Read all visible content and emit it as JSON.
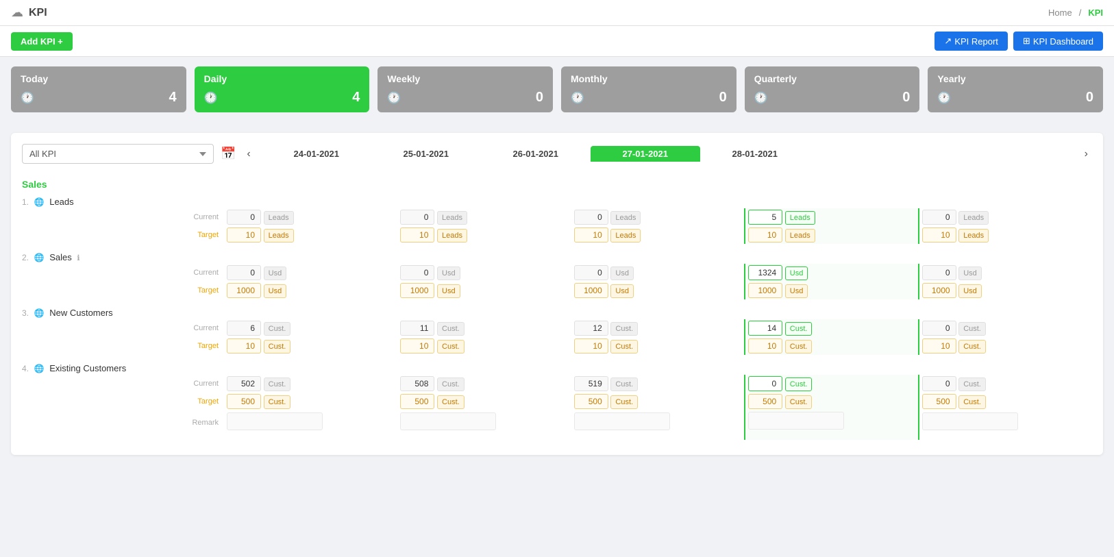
{
  "header": {
    "logo_icon": "☁",
    "title": "KPI",
    "breadcrumb_home": "Home",
    "breadcrumb_sep": "/",
    "breadcrumb_current": "KPI"
  },
  "toolbar": {
    "add_kpi_label": "Add KPI +",
    "report_label": "KPI Report",
    "dashboard_label": "KPI Dashboard"
  },
  "period_cards": [
    {
      "label": "Today",
      "value": "4",
      "active": false
    },
    {
      "label": "Daily",
      "value": "4",
      "active": true
    },
    {
      "label": "Weekly",
      "value": "0",
      "active": false
    },
    {
      "label": "Monthly",
      "value": "0",
      "active": false
    },
    {
      "label": "Quarterly",
      "value": "0",
      "active": false
    },
    {
      "label": "Yearly",
      "value": "0",
      "active": false
    }
  ],
  "filter": {
    "select_label": "All KPI",
    "select_options": [
      "All KPI"
    ]
  },
  "dates": [
    {
      "label": "24-01-2021",
      "active": false
    },
    {
      "label": "25-01-2021",
      "active": false
    },
    {
      "label": "26-01-2021",
      "active": false
    },
    {
      "label": "27-01-2021",
      "active": true
    },
    {
      "label": "28-01-2021",
      "active": false
    }
  ],
  "section_label": "Sales",
  "kpi_items": [
    {
      "number": "1.",
      "name": "Leads",
      "has_info": false,
      "rows": {
        "current_label": "Current",
        "target_label": "Target",
        "current_unit": "Leads",
        "target_unit": "Leads",
        "data": [
          {
            "current": "0",
            "target": "10"
          },
          {
            "current": "0",
            "target": "10"
          },
          {
            "current": "0",
            "target": "10"
          },
          {
            "current": "5",
            "target": "10"
          },
          {
            "current": "0",
            "target": "10"
          }
        ]
      }
    },
    {
      "number": "2.",
      "name": "Sales",
      "has_info": true,
      "rows": {
        "current_label": "Current",
        "target_label": "Target",
        "current_unit": "Usd",
        "target_unit": "Usd",
        "data": [
          {
            "current": "0",
            "target": "1000"
          },
          {
            "current": "0",
            "target": "1000"
          },
          {
            "current": "0",
            "target": "1000"
          },
          {
            "current": "1324",
            "target": "1000"
          },
          {
            "current": "0",
            "target": "1000"
          }
        ]
      }
    },
    {
      "number": "3.",
      "name": "New Customers",
      "has_info": false,
      "rows": {
        "current_label": "Current",
        "target_label": "Target",
        "current_unit": "Cust.",
        "target_unit": "Cust.",
        "data": [
          {
            "current": "6",
            "target": "10"
          },
          {
            "current": "11",
            "target": "10"
          },
          {
            "current": "12",
            "target": "10"
          },
          {
            "current": "14",
            "target": "10"
          },
          {
            "current": "0",
            "target": "10"
          }
        ]
      }
    },
    {
      "number": "4.",
      "name": "Existing Customers",
      "has_info": false,
      "has_remark": true,
      "rows": {
        "current_label": "Current",
        "target_label": "Target",
        "remark_label": "Remark",
        "current_unit": "Cust.",
        "target_unit": "Cust.",
        "data": [
          {
            "current": "502",
            "target": "500"
          },
          {
            "current": "508",
            "target": "500"
          },
          {
            "current": "519",
            "target": "500"
          },
          {
            "current": "0",
            "target": "500"
          },
          {
            "current": "0",
            "target": "500"
          }
        ]
      }
    }
  ]
}
